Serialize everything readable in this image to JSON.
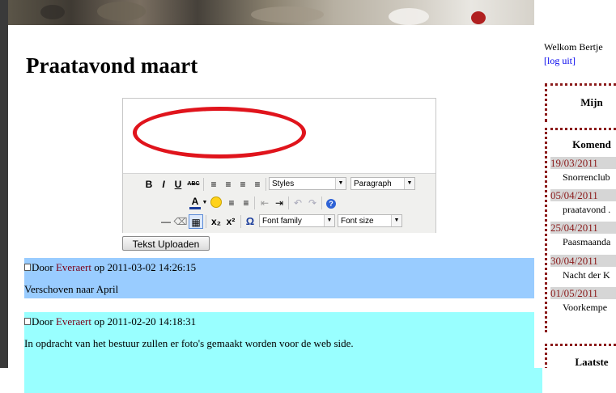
{
  "page": {
    "title": "Praatavond maart"
  },
  "editor": {
    "toolbar": {
      "bold": "B",
      "italic": "I",
      "underline": "U",
      "strikethrough": "ABC",
      "styles_label": "Styles",
      "format_label": "Paragraph",
      "font_color": "A",
      "subscript": "x₂",
      "superscript": "x²",
      "special_char": "Ω",
      "font_family_label": "Font family",
      "font_size_label": "Font size",
      "help": "?"
    },
    "upload_button": "Tekst Uploaden"
  },
  "comments": [
    {
      "prefix": "Door ",
      "author": "Everaert",
      "suffix": " op 2011-03-02 14:26:15",
      "text": "Verschoven naar April",
      "color": "#99ccff"
    },
    {
      "prefix": "Door ",
      "author": "Everaert",
      "suffix": " op 2011-02-20 14:18:31",
      "text": "In opdracht van het bestuur zullen er foto's gemaakt worden voor de web side.",
      "color": "#99ffff"
    }
  ],
  "sidebar": {
    "welcome": "Welkom Bertje",
    "logout": "[log uit]",
    "box_mine_title": "Mijn",
    "box_upcoming_title": "Komend",
    "events": [
      {
        "date": "19/03/2011",
        "name": "Snorrenclub"
      },
      {
        "date": "05/04/2011",
        "name": "praatavond ."
      },
      {
        "date": "25/04/2011",
        "name": "Paasmaanda"
      },
      {
        "date": "30/04/2011",
        "name": "Nacht der K"
      },
      {
        "date": "01/05/2011",
        "name": "Voorkempe"
      }
    ],
    "box_latest_title": "Laatste"
  },
  "colors": {
    "accent": "#8b1a1a",
    "highlight_mark": "#e0141c",
    "date_bg": "#d6d6d6"
  }
}
